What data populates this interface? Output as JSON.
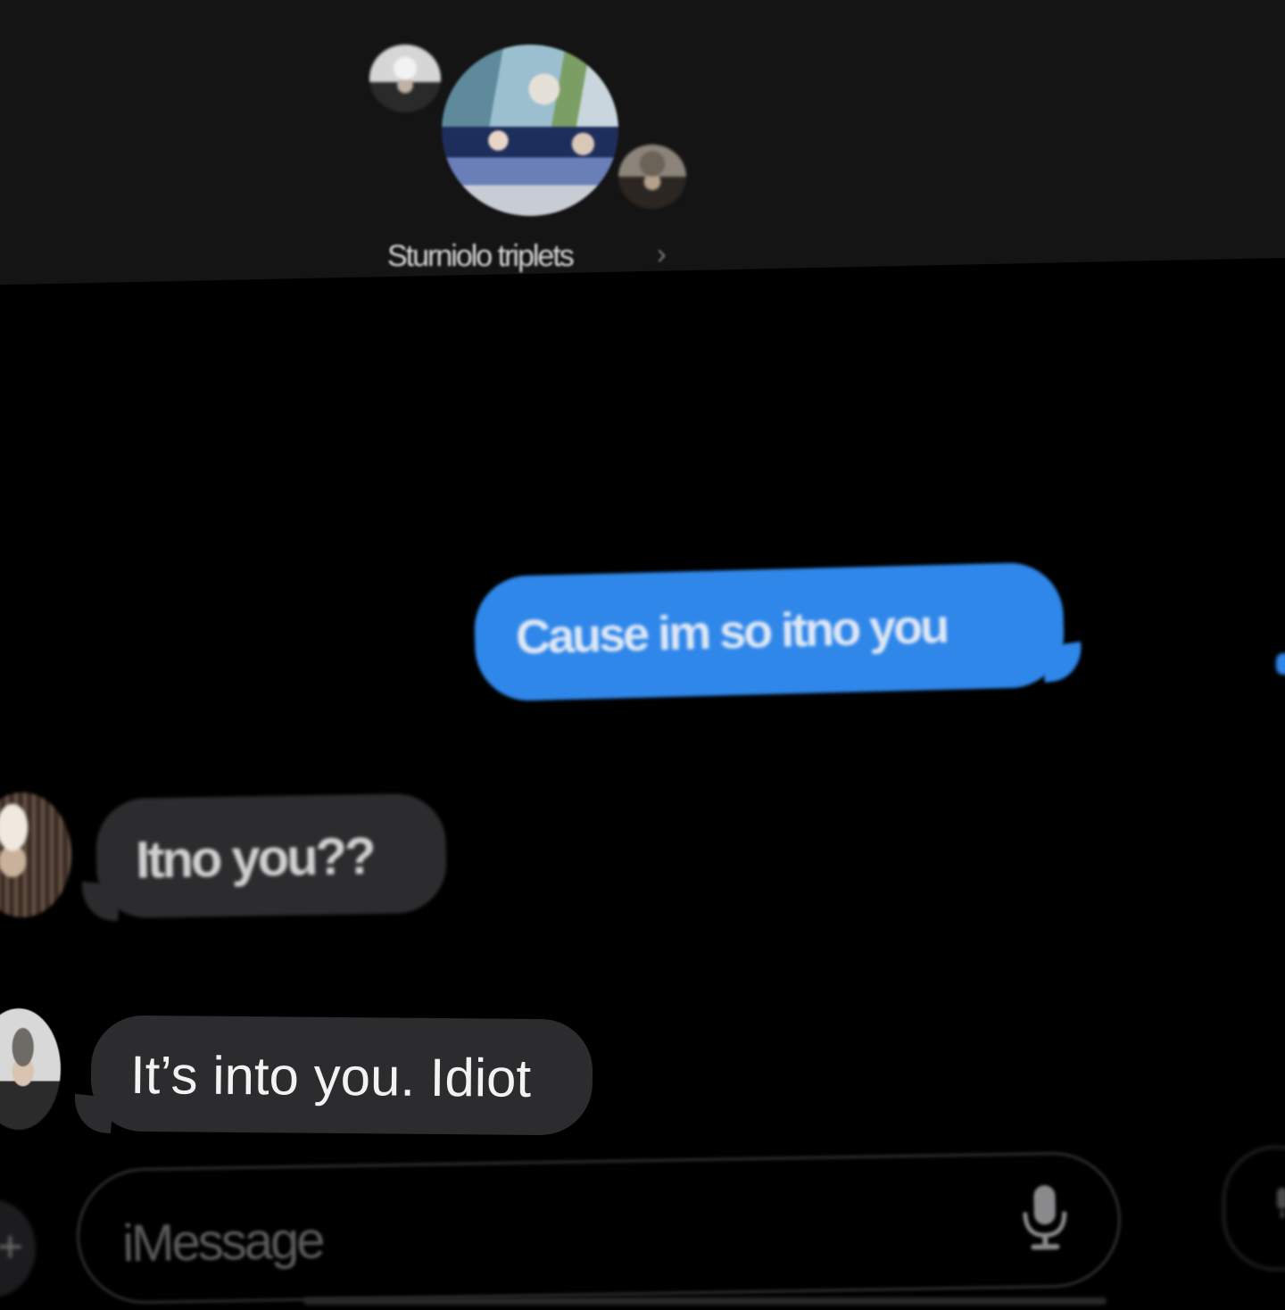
{
  "header": {
    "group_name": "Sturniolo triplets",
    "chevron": "›",
    "avatars": [
      "group-photo-avatar",
      "member-avatar-left",
      "member-avatar-right"
    ]
  },
  "messages": [
    {
      "direction": "sent",
      "text": "Cause im so itno you",
      "color": "#2f87ea"
    },
    {
      "direction": "received",
      "text": "Itno you??",
      "color": "#2c2c2e"
    },
    {
      "direction": "received",
      "text": "It’s into you. Idiot",
      "color": "#2c2c2e"
    }
  ],
  "composer": {
    "placeholder": "iMessage",
    "plus_glyph": "+",
    "icons": [
      "plus-icon",
      "microphone-icon",
      "audio-record-icon"
    ]
  },
  "colors": {
    "background": "#000000",
    "header": "#141414",
    "sent_bubble": "#2f87ea",
    "received_bubble": "#2c2c2e"
  }
}
